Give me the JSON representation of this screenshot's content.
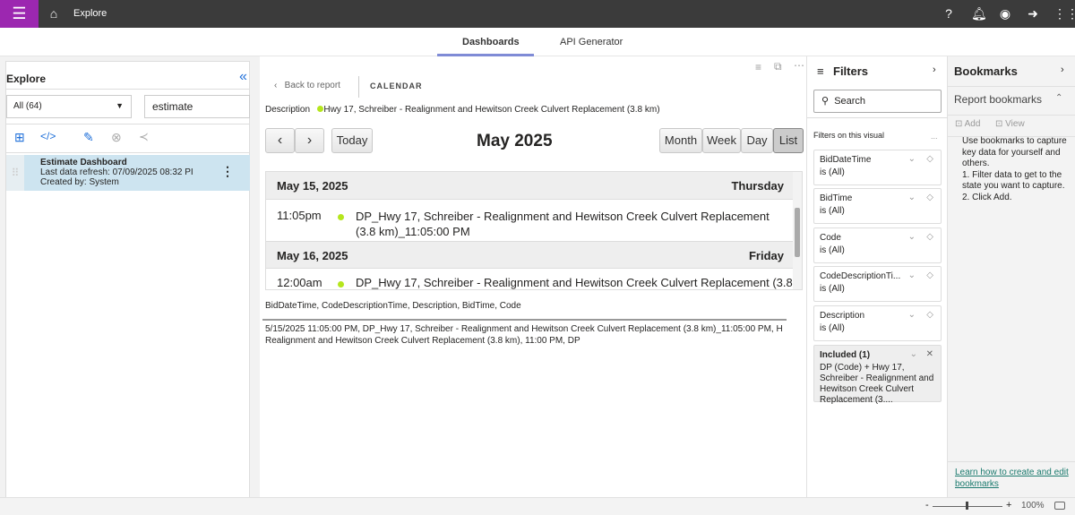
{
  "topbar": {
    "title": "Explore"
  },
  "tabs": [
    {
      "label": "Dashboards",
      "active": true
    },
    {
      "label": "API Generator",
      "active": false
    }
  ],
  "explore": {
    "title": "Explore",
    "filter_select": "All (64)",
    "search_value": "estimate",
    "item": {
      "title": "Estimate Dashboard",
      "refresh": "Last data refresh: 07/09/2025 08:32 PI",
      "created": "Created by: System"
    }
  },
  "report": {
    "back": "Back to report",
    "visual_title": "CALENDAR",
    "legend_label": "Description",
    "legend_item": "Hwy 17, Schreiber - Realignment and Hewitson Creek Culvert Replacement (3.8 km)",
    "legend_color": "#b5e61d",
    "calendar": {
      "title": "May 2025",
      "today": "Today",
      "views": [
        "Month",
        "Week",
        "Day",
        "List"
      ],
      "active_view": "List",
      "days": [
        {
          "date": "May 15, 2025",
          "weekday": "Thursday",
          "events": [
            {
              "time": "11:05pm",
              "title": "DP_Hwy 17, Schreiber - Realignment and Hewitson Creek Culvert Replacement (3.8 km)_11:05:00 PM"
            }
          ]
        },
        {
          "date": "May 16, 2025",
          "weekday": "Friday",
          "events": [
            {
              "time": "12:00am",
              "title": "DP_Hwy 17, Schreiber - Realignment and Hewitson Creek Culvert Replacement (3.8"
            }
          ]
        }
      ]
    },
    "fields": "BidDateTime, CodeDescriptionTime, Description, BidTime, Code",
    "tooltip_line1": "5/15/2025 11:05:00 PM, DP_Hwy 17, Schreiber - Realignment and Hewitson Creek Culvert Replacement (3.8 km)_11:05:00 PM, H",
    "tooltip_line2": "Realignment and Hewitson Creek Culvert Replacement (3.8 km), 11:00 PM, DP"
  },
  "filters": {
    "title": "Filters",
    "search_placeholder": "Search",
    "section": "Filters on this visual",
    "more": "...",
    "cards": [
      {
        "name": "BidDateTime",
        "value": "is (All)"
      },
      {
        "name": "BidTime",
        "value": "is (All)"
      },
      {
        "name": "Code",
        "value": "is (All)"
      },
      {
        "name": "CodeDescriptionTi...",
        "value": "is (All)"
      },
      {
        "name": "Description",
        "value": "is (All)"
      }
    ],
    "included": {
      "title": "Included (1)",
      "text": "DP (Code) + Hwy 17, Schreiber - Realignment and Hewitson Creek Culvert Replacement (3...."
    }
  },
  "bookmarks": {
    "title": "Bookmarks",
    "section": "Report bookmarks",
    "add": "Add",
    "view": "View",
    "help": "Use bookmarks to capture key data for yourself and others.\n1. Filter data to get to the state you want to capture.\n2. Click Add.",
    "link": "Learn how to create and edit bookmarks"
  },
  "status": {
    "zoom_minus": "-",
    "zoom_plus": "+",
    "zoom": "100%",
    "zoom_level": 100
  }
}
